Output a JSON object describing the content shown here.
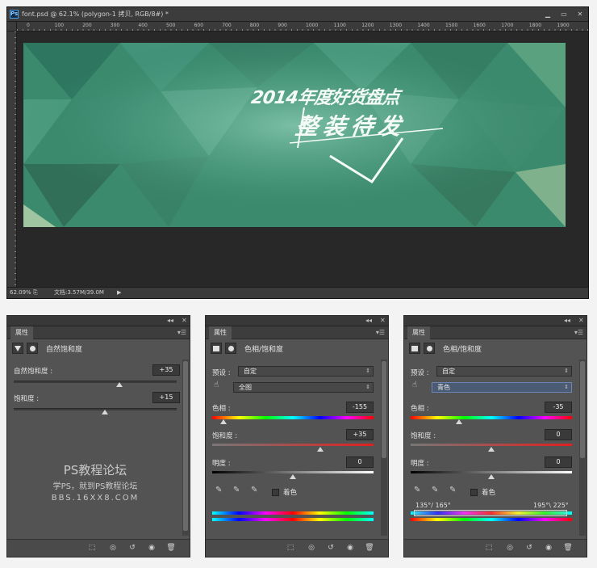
{
  "doc": {
    "title": "font.psd @ 62.1% (polygon-1 拷贝, RGB/8#) *",
    "ruler_ticks": [
      "0",
      "100",
      "200",
      "300",
      "400",
      "500",
      "600",
      "700",
      "800",
      "900",
      "1000",
      "1100",
      "1200",
      "1300",
      "1400",
      "1500",
      "1600",
      "1700",
      "1800",
      "1900"
    ],
    "zoom": "62.09%",
    "file_info": "文档:3.57M/39.0M",
    "artwork_text": {
      "line1": "2014年度好货盘点",
      "line2": "整装待发"
    },
    "colors": {
      "image_dark": "#2c6e54",
      "image_mid": "#4b9a7e"
    }
  },
  "panels": [
    {
      "tab": "属性",
      "header_title": "自然饱和度",
      "rows": [
        {
          "label": "自然饱和度 :",
          "value": "+35",
          "position": 0.65
        },
        {
          "label": "饱和度 :",
          "value": "+15",
          "position": 0.56
        }
      ],
      "watermark": {
        "line1": "PS教程论坛",
        "line2": "学PS，就到PS教程论坛",
        "line3": "BBS.16XX8.COM"
      }
    },
    {
      "tab": "属性",
      "header_title": "色相/饱和度",
      "preset_label": "预设 :",
      "preset_value": "自定",
      "channel_value": "全图",
      "hue_label": "色相 :",
      "hue_value": "-155",
      "hue_position": 0.07,
      "sat_label": "饱和度 :",
      "sat_value": "+35",
      "sat_position": 0.67,
      "light_label": "明度 :",
      "light_value": "0",
      "light_position": 0.5,
      "colorize_label": "着色"
    },
    {
      "tab": "属性",
      "header_title": "色相/饱和度",
      "preset_label": "预设 :",
      "preset_value": "自定",
      "channel_value": "青色",
      "hue_label": "色相 :",
      "hue_value": "-35",
      "hue_position": 0.3,
      "sat_label": "饱和度 :",
      "sat_value": "0",
      "sat_position": 0.5,
      "light_label": "明度 :",
      "light_value": "0",
      "light_position": 0.5,
      "colorize_label": "着色",
      "range_left": "135°/ 165°",
      "range_right": "195°\\ 225°"
    }
  ]
}
